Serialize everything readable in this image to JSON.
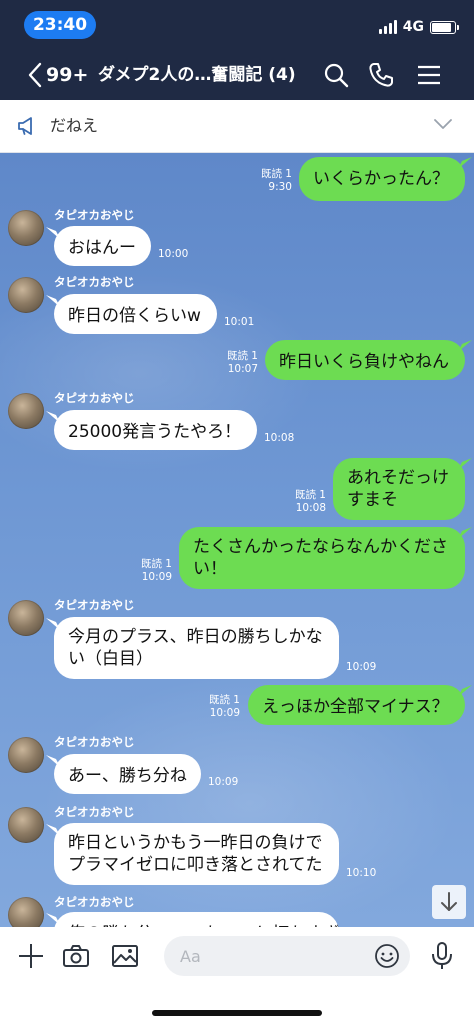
{
  "status_bar": {
    "time": "23:40",
    "network": "4G"
  },
  "header": {
    "back_count": "99+",
    "title": "ダメプ2人の…奮闘記 (4)"
  },
  "announcement": {
    "text": "だねえ"
  },
  "messages": [
    {
      "dir": "out",
      "text": "いくらかったん？",
      "read": "既読 1",
      "time": "9:30"
    },
    {
      "dir": "in",
      "sender": "タピオカおやじ",
      "text": "おはんー",
      "time": "10:00"
    },
    {
      "dir": "in",
      "sender": "タピオカおやじ",
      "text": "昨日の倍くらいw",
      "time": "10:01"
    },
    {
      "dir": "out",
      "text": "昨日いくら負けやねん",
      "read": "既読 1",
      "time": "10:07"
    },
    {
      "dir": "in",
      "sender": "タピオカおやじ",
      "text": "25000発言うたやろ！",
      "time": "10:08"
    },
    {
      "dir": "out",
      "lines": [
        "あれそだっけ",
        "すまそ"
      ],
      "read": "既読 1",
      "time": "10:08"
    },
    {
      "dir": "out",
      "lines": [
        "たくさんかったならなんかくださ",
        "い！"
      ],
      "read": "既読 1",
      "time": "10:09"
    },
    {
      "dir": "in",
      "sender": "タピオカおやじ",
      "lines": [
        "今月のプラス、昨日の勝ちしかな",
        "い（白目）"
      ],
      "time": "10:09"
    },
    {
      "dir": "out",
      "text": "えっほか全部マイナス？",
      "read": "既読 1",
      "time": "10:09"
    },
    {
      "dir": "in",
      "sender": "タピオカおやじ",
      "text": "あー、勝ち分ね",
      "time": "10:09"
    },
    {
      "dir": "in",
      "sender": "タピオカおやじ",
      "lines": [
        "昨日というかもう一昨日の負けで",
        "プラマイゼロに叩き落とされてた"
      ],
      "time": "10:10"
    },
    {
      "dir": "in",
      "sender": "タピオカおやじ",
      "text": "俺の勝ち分・・・ちょっと打ちすぎた"
    }
  ],
  "input": {
    "placeholder": "Aa"
  },
  "colors": {
    "header_bg": "#1f2a44",
    "time_pill": "#1d7cf2",
    "outgoing_bubble": "#6ddc52",
    "incoming_bubble": "#ffffff"
  },
  "icons": [
    "back-chevron-icon",
    "search-icon",
    "phone-icon",
    "menu-icon",
    "megaphone-icon",
    "chevron-down-icon",
    "arrow-down-icon",
    "plus-icon",
    "camera-icon",
    "image-icon",
    "emoji-icon",
    "microphone-icon"
  ]
}
